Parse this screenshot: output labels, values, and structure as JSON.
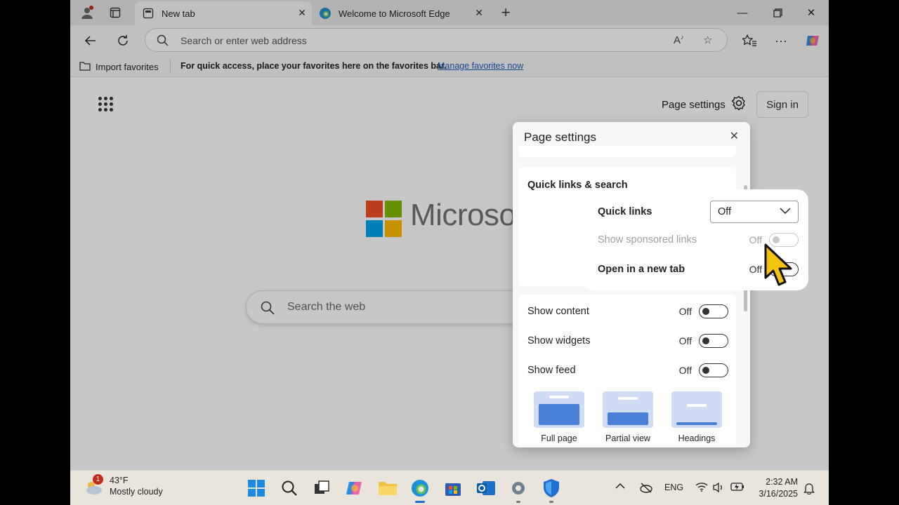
{
  "tabs": [
    {
      "label": "New tab",
      "active": true
    },
    {
      "label": "Welcome to Microsoft Edge",
      "active": false
    }
  ],
  "address": {
    "placeholder": "Search or enter web address"
  },
  "favorites_bar": {
    "import_label": "Import favorites",
    "message": "For quick access, place your favorites here on the favorites bar.",
    "link": "Manage favorites now"
  },
  "header": {
    "page_settings_label": "Page settings",
    "sign_in_label": "Sign in"
  },
  "brand": {
    "word": "Microso",
    "colors": [
      "#f25022",
      "#7fba00",
      "#00a4ef",
      "#ffb900"
    ]
  },
  "web_search": {
    "placeholder": "Search the web"
  },
  "panel": {
    "title": "Page settings",
    "section_title": "Quick links & search",
    "quick_links": {
      "label": "Quick links",
      "value": "Off"
    },
    "sponsored": {
      "label": "Show sponsored links",
      "state": "Off"
    },
    "new_tab": {
      "label": "Open in a new tab",
      "state": "Off"
    },
    "show_content": {
      "label": "Show content",
      "state": "Off"
    },
    "show_widgets": {
      "label": "Show widgets",
      "state": "Off"
    },
    "show_feed": {
      "label": "Show feed",
      "state": "Off"
    },
    "layouts": [
      {
        "label": "Full page"
      },
      {
        "label": "Partial view"
      },
      {
        "label": "Headings"
      }
    ]
  },
  "taskbar": {
    "weather": {
      "temp": "43°F",
      "condition": "Mostly cloudy",
      "badge": "1"
    },
    "language": "ENG",
    "time": "2:32 AM",
    "date": "3/16/2025"
  }
}
